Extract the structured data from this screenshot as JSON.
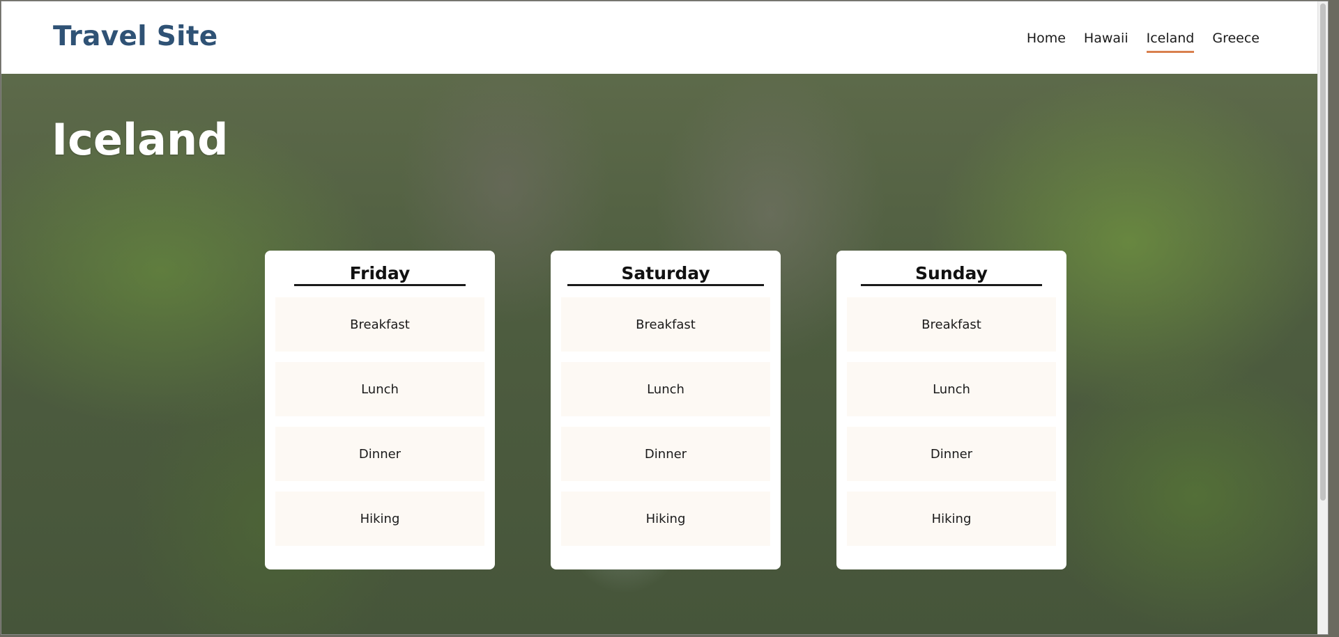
{
  "header": {
    "site_title": "Travel Site",
    "nav": [
      {
        "label": "Home",
        "active": false
      },
      {
        "label": "Hawaii",
        "active": false
      },
      {
        "label": "Iceland",
        "active": true
      },
      {
        "label": "Greece",
        "active": false
      }
    ]
  },
  "hero": {
    "title": "Iceland",
    "background": "moss-covered canyon photo"
  },
  "days": [
    {
      "name": "Friday",
      "activities": [
        "Breakfast",
        "Lunch",
        "Dinner",
        "Hiking"
      ]
    },
    {
      "name": "Saturday",
      "activities": [
        "Breakfast",
        "Lunch",
        "Dinner",
        "Hiking"
      ]
    },
    {
      "name": "Sunday",
      "activities": [
        "Breakfast",
        "Lunch",
        "Dinner",
        "Hiking"
      ]
    }
  ],
  "colors": {
    "title": "#2f5275",
    "nav_active_underline": "#d9804e",
    "activity_bg": "#fdf9f4"
  }
}
